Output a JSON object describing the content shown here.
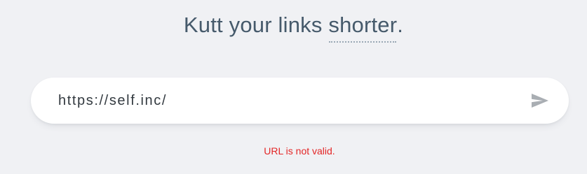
{
  "headline": {
    "prefix": "Kutt your links ",
    "accent": "shorter",
    "suffix": "."
  },
  "form": {
    "url_value": "https://self.inc/",
    "submit_icon": "send-icon"
  },
  "error": {
    "message": "URL is not valid."
  },
  "colors": {
    "background": "#f0f1f4",
    "headline": "#465a6b",
    "error": "#e32626",
    "icon": "#a9aeb3"
  }
}
